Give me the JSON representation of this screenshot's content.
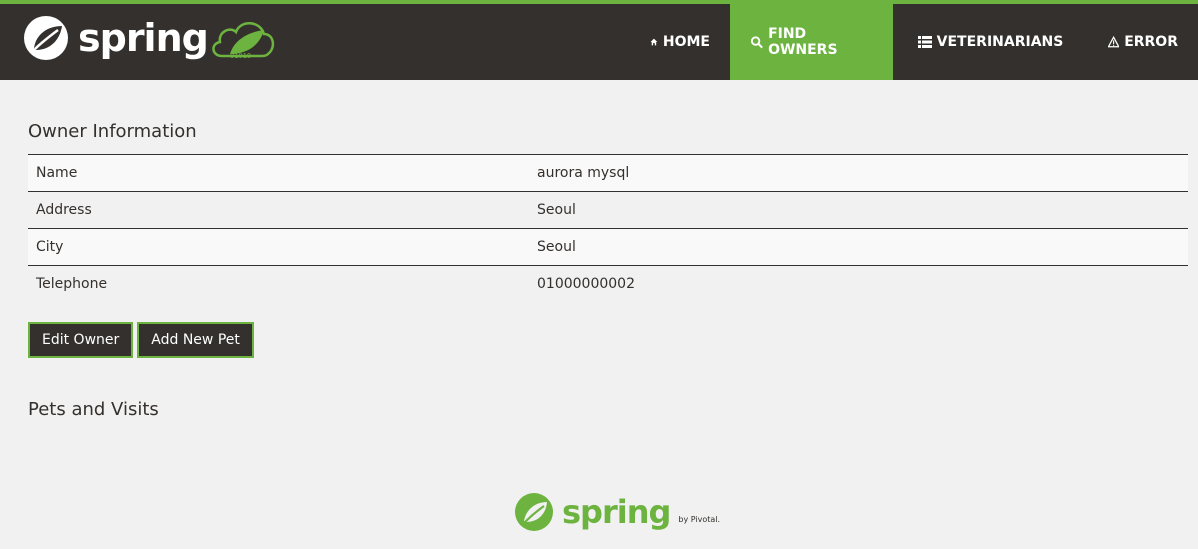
{
  "brand": {
    "name": "spring",
    "cloud_text": "01010"
  },
  "nav": [
    {
      "label": "Home",
      "icon": "home-icon",
      "active": false
    },
    {
      "label": "Find owners",
      "icon": "search-icon",
      "active": true
    },
    {
      "label": "Veterinarians",
      "icon": "list-icon",
      "active": false
    },
    {
      "label": "Error",
      "icon": "warning-icon",
      "active": false
    }
  ],
  "owner": {
    "title": "Owner Information",
    "rows": [
      {
        "label": "Name",
        "value": "aurora mysql"
      },
      {
        "label": "Address",
        "value": "Seoul"
      },
      {
        "label": "City",
        "value": "Seoul"
      },
      {
        "label": "Telephone",
        "value": "01000000002"
      }
    ]
  },
  "actions": {
    "edit_label": "Edit Owner",
    "add_pet_label": "Add New Pet"
  },
  "pets": {
    "title": "Pets and Visits"
  },
  "footer": {
    "name": "spring",
    "by": "by Pivotal."
  },
  "colors": {
    "accent": "#6db33f",
    "dark": "#34302d",
    "background": "#f1f1f1"
  }
}
